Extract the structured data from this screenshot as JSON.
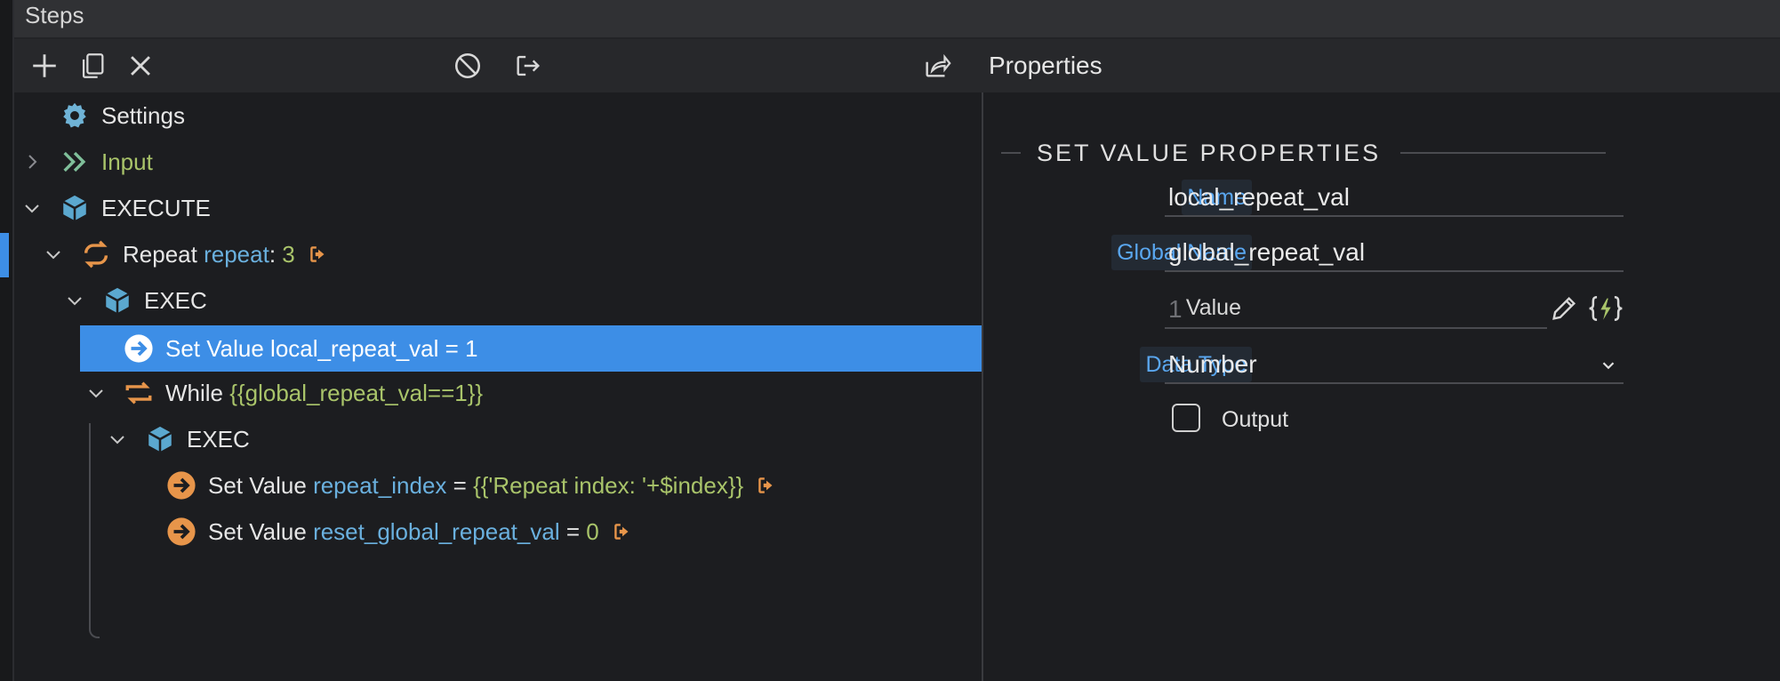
{
  "window": {
    "title": "Steps"
  },
  "toolbar": {
    "properties_label": "Properties"
  },
  "tree": {
    "settings": {
      "label": "Settings"
    },
    "input": {
      "label": "Input"
    },
    "execute": {
      "label": "EXECUTE"
    },
    "repeat": {
      "label": "Repeat",
      "key": "repeat",
      "colon": ":",
      "value": "3"
    },
    "exec1": {
      "label": "EXEC"
    },
    "setvalue_selected": {
      "label": "Set Value local_repeat_val = 1"
    },
    "while": {
      "label": "While",
      "condition": "{{global_repeat_val==1}}"
    },
    "exec2": {
      "label": "EXEC"
    },
    "setvalue_index": {
      "label": "Set Value",
      "name": "repeat_index",
      "eq": "=",
      "expr": "{{'Repeat index: '+$index}}"
    },
    "setvalue_reset": {
      "label": "Set Value",
      "name": "reset_global_repeat_val",
      "eq": "=",
      "expr": "0"
    }
  },
  "properties": {
    "section_title": "SET VALUE PROPERTIES",
    "name": {
      "label": "Name",
      "value": "local_repeat_val"
    },
    "global_name": {
      "label": "Global Name",
      "value": "global_repeat_val"
    },
    "value": {
      "label": "Value",
      "placeholder": "1"
    },
    "data_type": {
      "label": "Data Type",
      "value": "Number"
    },
    "output": {
      "label": "Output",
      "checked": false
    }
  },
  "colors": {
    "accent_blue": "#3d8ee6",
    "step_orange": "#e7954a",
    "expr_green": "#a9c46a",
    "name_blue": "#6ab0de",
    "label_blue": "#5aa7f0"
  }
}
